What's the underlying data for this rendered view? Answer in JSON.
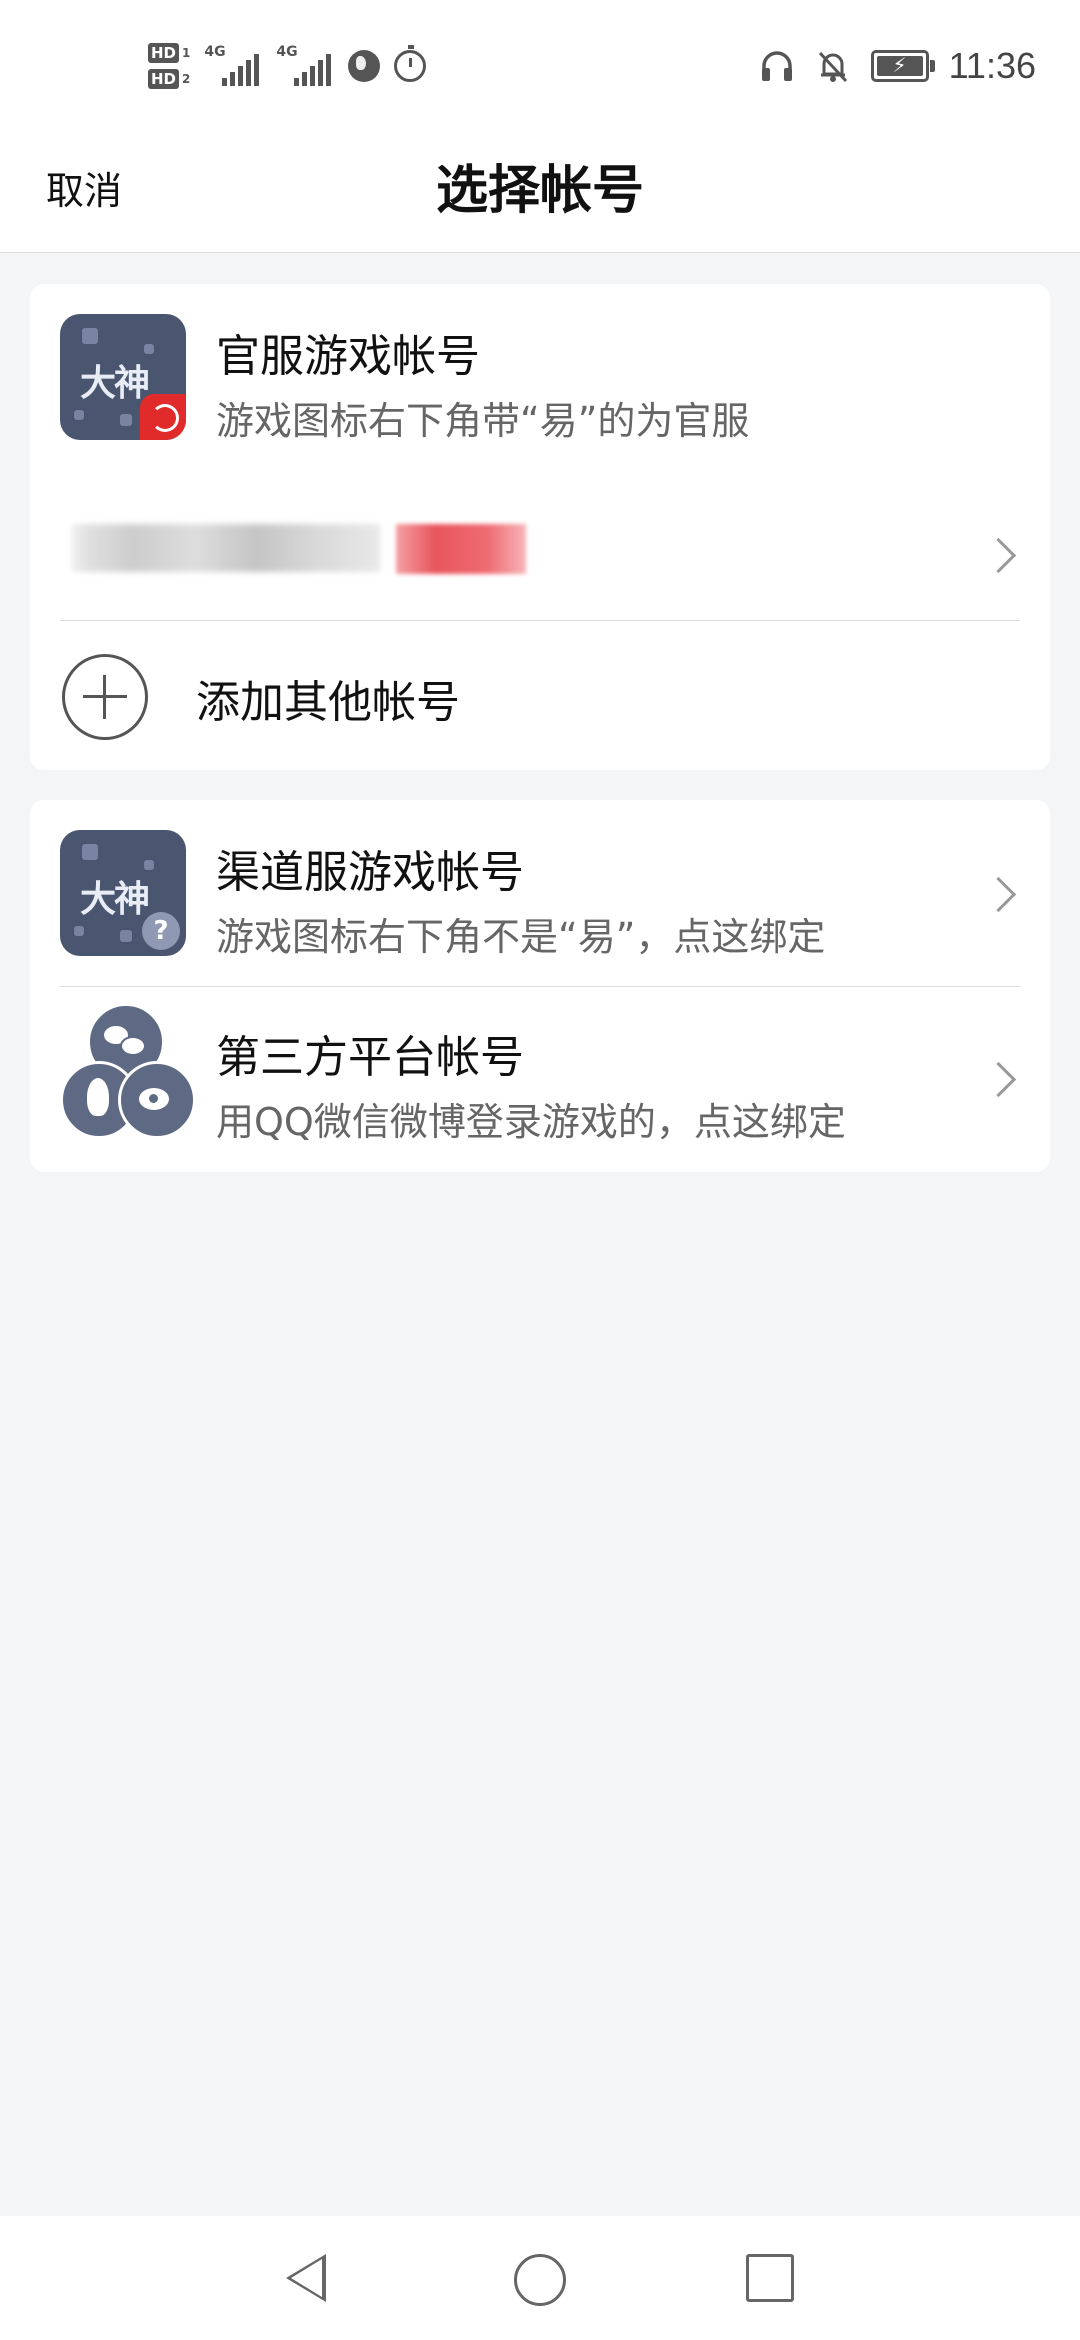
{
  "status_bar": {
    "hd1": "HD",
    "hd1_num": "1",
    "hd2": "HD",
    "hd2_num": "2",
    "network1": "4G",
    "network2": "4G",
    "time": "11:36",
    "icons": [
      "hd-icon",
      "signal-icon",
      "globe-icon",
      "timer-icon",
      "headphones-icon",
      "mute-bell-icon",
      "battery-charging-icon"
    ]
  },
  "header": {
    "cancel_label": "取消",
    "title": "选择帐号"
  },
  "official": {
    "icon_text": "大神",
    "title": "官服游戏帐号",
    "subtitle": "游戏图标右下角带“易”的为官服",
    "add_label": "添加其他帐号"
  },
  "channel": {
    "icon_text": "大神",
    "title": "渠道服游戏帐号",
    "subtitle": "游戏图标右下角不是“易”，点这绑定"
  },
  "third_party": {
    "title": "第三方平台帐号",
    "subtitle": "用QQ微信微博登录游戏的，点这绑定"
  },
  "colors": {
    "background": "#f4f5f7",
    "card": "#ffffff",
    "icon_bg": "#4a5570",
    "brand_red": "#e12a2a"
  }
}
